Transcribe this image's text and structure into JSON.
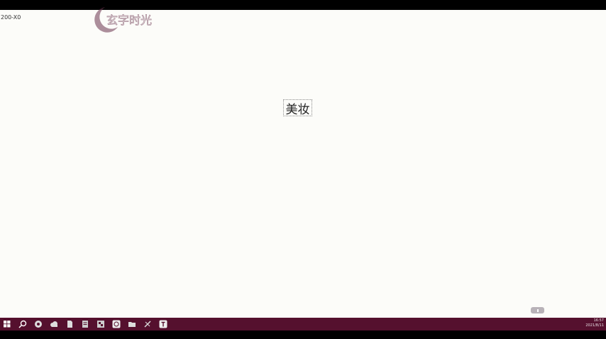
{
  "window": {
    "zoom_readout": "200-X0",
    "slide_text": "美妆"
  },
  "watermark": {
    "icon": "crescent-logo-icon",
    "text": "玄字时光",
    "color": "#6b3550"
  },
  "taskbar": {
    "color": "#55102e",
    "icons": [
      "windows-start-icon",
      "search-icon",
      "browser-icon",
      "cloud-icon",
      "file-icon",
      "document-icon",
      "media-icon",
      "app-icon",
      "folder-icon",
      "pin-icon",
      "text-app-icon"
    ],
    "clock_time": "16:57",
    "clock_date": "2021/8/11"
  }
}
